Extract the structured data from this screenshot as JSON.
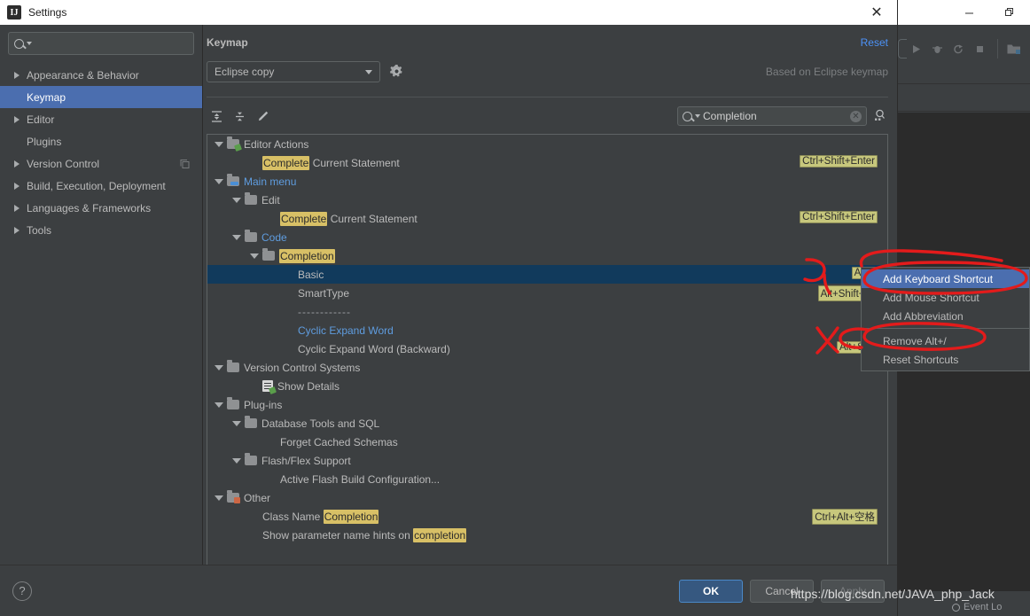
{
  "window": {
    "title": "Settings",
    "app_icon": "intellij-idea-icon",
    "close_icon": "close-icon"
  },
  "ide_background": {
    "minimize_icon": "minimize-icon",
    "restore_icon": "restore-icon",
    "toolbar_icons": [
      "run-icon",
      "debug-icon",
      "rerun-icon",
      "stop-icon",
      "project-icon"
    ],
    "status_bar": {
      "event_log_label": "Event Lo"
    }
  },
  "sidebar": {
    "search": {
      "placeholder": "",
      "value": "",
      "icon": "search-icon"
    },
    "items": [
      {
        "label": "Appearance & Behavior",
        "expandable": true,
        "selected": false
      },
      {
        "label": "Keymap",
        "expandable": false,
        "selected": true
      },
      {
        "label": "Editor",
        "expandable": true,
        "selected": false
      },
      {
        "label": "Plugins",
        "expandable": false,
        "selected": false
      },
      {
        "label": "Version Control",
        "expandable": true,
        "selected": false,
        "badge_icon": "copy-icon"
      },
      {
        "label": "Build, Execution, Deployment",
        "expandable": true,
        "selected": false
      },
      {
        "label": "Languages & Frameworks",
        "expandable": true,
        "selected": false
      },
      {
        "label": "Tools",
        "expandable": true,
        "selected": false
      }
    ]
  },
  "pane": {
    "title": "Keymap",
    "reset_label": "Reset",
    "keymap_select_value": "Eclipse copy",
    "gear_icon": "gear-icon",
    "based_on_label": "Based on Eclipse keymap",
    "toolbar": {
      "expand_all_icon": "expand-all-icon",
      "collapse_all_icon": "collapse-all-icon",
      "edit_icon": "pencil-edit-icon"
    },
    "filter": {
      "value": "Completion",
      "placeholder": "",
      "search_icon": "search-icon",
      "clear_icon": "clear-circle-icon",
      "find_shortcut_icon": "find-by-shortcut-icon"
    }
  },
  "tree": {
    "rows": [
      {
        "indent": 0,
        "arrow": true,
        "icon": "folder-green",
        "text": "Editor Actions",
        "color": "normal"
      },
      {
        "indent": 2,
        "arrow": false,
        "icon": "none",
        "text_parts": [
          {
            "t": "Complete",
            "hl": true
          },
          {
            "t": " Current Statement",
            "hl": false
          }
        ],
        "shortcut": "Ctrl+Shift+Enter"
      },
      {
        "indent": 0,
        "arrow": true,
        "icon": "folder-blue",
        "text": "Main menu",
        "color": "blue"
      },
      {
        "indent": 1,
        "arrow": true,
        "icon": "folder",
        "text": "Edit",
        "color": "normal"
      },
      {
        "indent": 3,
        "arrow": false,
        "icon": "none",
        "text_parts": [
          {
            "t": "Complete",
            "hl": true
          },
          {
            "t": " Current Statement",
            "hl": false
          }
        ],
        "shortcut": "Ctrl+Shift+Enter"
      },
      {
        "indent": 1,
        "arrow": true,
        "icon": "folder",
        "text": "Code",
        "color": "blue"
      },
      {
        "indent": 2,
        "arrow": true,
        "icon": "folder",
        "text_parts": [
          {
            "t": "Completion",
            "hl": true
          }
        ]
      },
      {
        "indent": 4,
        "arrow": false,
        "icon": "none",
        "text": "Basic",
        "selected": true,
        "shortcut": "Alt+/"
      },
      {
        "indent": 4,
        "arrow": false,
        "icon": "none",
        "text": "SmartType",
        "shortcut": "Alt+Shift+空"
      },
      {
        "indent": 4,
        "arrow": false,
        "icon": "none",
        "text": "------------",
        "dashes": true
      },
      {
        "indent": 4,
        "arrow": false,
        "icon": "none",
        "text": "Cyclic Expand Word",
        "color": "blue"
      },
      {
        "indent": 4,
        "arrow": false,
        "icon": "none",
        "text": "Cyclic Expand Word (Backward)",
        "shortcut": "Alt+Shif"
      },
      {
        "indent": 0,
        "arrow": true,
        "icon": "folder",
        "text": "Version Control Systems",
        "color": "normal"
      },
      {
        "indent": 2,
        "arrow": false,
        "icon": "doc-green",
        "text": "Show Details",
        "color": "normal"
      },
      {
        "indent": 0,
        "arrow": true,
        "icon": "folder",
        "text": "Plug-ins",
        "color": "normal"
      },
      {
        "indent": 1,
        "arrow": true,
        "icon": "folder",
        "text": "Database Tools and SQL",
        "color": "normal"
      },
      {
        "indent": 3,
        "arrow": false,
        "icon": "none",
        "text": "Forget Cached Schemas",
        "color": "normal"
      },
      {
        "indent": 1,
        "arrow": true,
        "icon": "folder",
        "text": "Flash/Flex Support",
        "color": "normal"
      },
      {
        "indent": 3,
        "arrow": false,
        "icon": "none",
        "text": "Active Flash Build Configuration...",
        "color": "normal"
      },
      {
        "indent": 0,
        "arrow": true,
        "icon": "folder-multi",
        "text": "Other",
        "color": "normal"
      },
      {
        "indent": 2,
        "arrow": false,
        "icon": "none",
        "text_parts": [
          {
            "t": "Class Name ",
            "hl": false
          },
          {
            "t": "Completion",
            "hl": true
          }
        ],
        "shortcut": "Ctrl+Alt+空格"
      },
      {
        "indent": 2,
        "arrow": false,
        "icon": "none",
        "text_parts": [
          {
            "t": "Show parameter name hints on ",
            "hl": false
          },
          {
            "t": "completion",
            "hl": true
          }
        ]
      }
    ]
  },
  "context_menu": {
    "items": [
      {
        "label": "Add Keyboard Shortcut",
        "active": true
      },
      {
        "label": "Add Mouse Shortcut",
        "active": false
      },
      {
        "label": "Add Abbreviation",
        "active": false
      },
      {
        "separator_after": true
      },
      {
        "label": "Remove Alt+/",
        "active": false
      },
      {
        "label": "Reset Shortcuts",
        "active": false
      }
    ]
  },
  "footer": {
    "help_label": "?",
    "ok_label": "OK",
    "cancel_label": "Cancel",
    "apply_label": "Apply"
  },
  "watermark": {
    "text": "https://blog.csdn.net/JAVA_php_Jack"
  },
  "colors": {
    "accent_blue": "#4b6eaf",
    "link_blue": "#4c92f7",
    "highlight_yellow": "#d8c066",
    "shortcut_badge": "#c7c77c",
    "selection_navy": "#113a5c",
    "annotation_red": "#e31b1b",
    "panel_bg": "#3c3f41"
  }
}
